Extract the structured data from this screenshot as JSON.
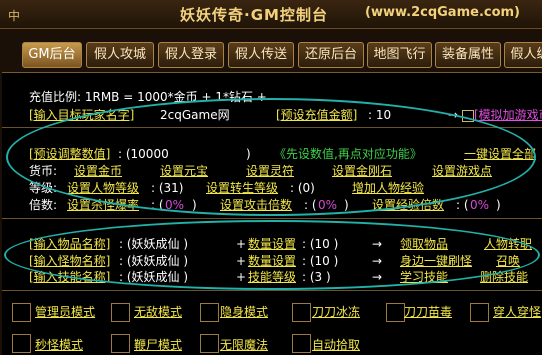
{
  "title": {
    "icon": "中",
    "main": "妖妖传奇·GM控制台",
    "url": "(www.2cqGame.com)"
  },
  "tabs": [
    "GM后台",
    "假人攻城",
    "假人登录",
    "假人传送",
    "还原后台",
    "地图飞行",
    "装备属性",
    "假人编"
  ],
  "recharge": {
    "ratio": "充值比例: 1RMB = 1000*金币 + 1*钻石 +",
    "target_label": "[输入目标玩家名字]",
    "target_value": "2cqGame网",
    "preset_label": "[预设充值金额]",
    "preset_value": ": 10",
    "arrow": "→",
    "simulate": "[模拟加游戏币"
  },
  "values": {
    "preset_label": "[预设调整数值]",
    "preset_value": ": (10000",
    "close": ")",
    "hint": "《先设数值,再点对应功能》",
    "one_click": "一键设置全部"
  },
  "currency": {
    "label": "货币:",
    "items": [
      "设置金币",
      "设置元宝",
      "设置灵符",
      "设置金刚石",
      "设置游戏点"
    ]
  },
  "level": {
    "label": "等级:",
    "person": "设置人物等级",
    "person_val": ": (31)",
    "rebirth": "设置转生等级",
    "rebirth_val": ": (0)",
    "exp": "增加人物经验"
  },
  "multiplier": {
    "label": "倍数:",
    "kill": "设置杀怪爆率",
    "kill_val": ": (",
    "kill_pct": "0%",
    "attack": "设置攻击倍数",
    "attack_val": ": (",
    "attack_pct": "0%",
    "expx": "设置经验倍数",
    "expx_val": ": (",
    "expx_pct": "0%",
    "close": ")"
  },
  "items": [
    {
      "label": "[输入物品名称]",
      "value": ": (妖妖成仙 )",
      "plus": "+",
      "count_label": "数量设置",
      "count_val": ": (10 )",
      "arrow": "→",
      "action": "领取物品",
      "extra": "人物转职"
    },
    {
      "label": "[输入怪物名称]",
      "value": ": (妖妖成仙 )",
      "plus": "+",
      "count_label": "数量设置",
      "count_val": ": (10 )",
      "arrow": "→",
      "action": "身边一键刷怪",
      "extra": "召唤"
    },
    {
      "label": "[输入技能名称]",
      "value": ": (妖妖成仙 )",
      "plus": "+",
      "count_label": "技能等级",
      "count_val": ": (3 )",
      "arrow": "→",
      "action": "学习技能",
      "extra": "删除技能"
    }
  ],
  "modes_row1": [
    "管理员模式",
    "无敌模式",
    "隐身模式",
    "刀刀冰冻",
    "刀刀苗毒",
    "穿人穿怪"
  ],
  "modes_row2": [
    "秒怪模式",
    "鞭尸模式",
    "无限魔法",
    "自动拾取"
  ]
}
